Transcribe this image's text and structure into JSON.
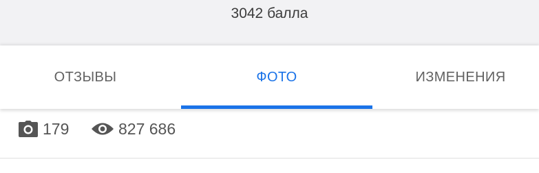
{
  "points": {
    "text": "3042 балла"
  },
  "tabs": [
    {
      "label": "ОТЗЫВЫ",
      "active": false
    },
    {
      "label": "ФОТО",
      "active": true
    },
    {
      "label": "ИЗМЕНЕНИЯ",
      "active": false
    }
  ],
  "stats": {
    "photos": {
      "icon": "camera-icon",
      "value": "179"
    },
    "views": {
      "icon": "eye-icon",
      "value": "827 686"
    }
  },
  "colors": {
    "accent": "#1a73e8",
    "tab_text": "#616161",
    "header_bg": "#f2f2f4",
    "icon": "#555555"
  }
}
